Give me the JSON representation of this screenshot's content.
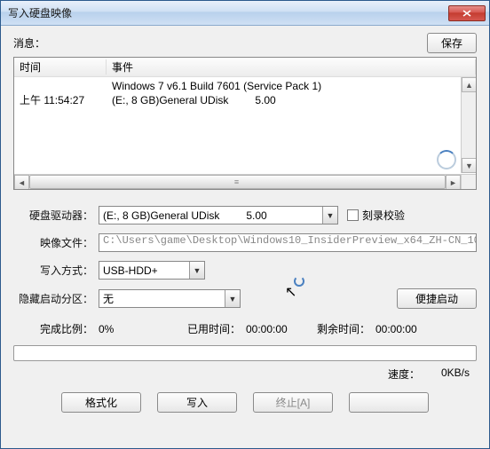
{
  "window": {
    "title": "写入硬盘映像"
  },
  "top": {
    "info_label": "消息：",
    "save_btn": "保存"
  },
  "log": {
    "headers": {
      "time": "时间",
      "event": "事件"
    },
    "rows": [
      {
        "time": "",
        "event": "Windows 7 v6.1 Build 7601 (Service Pack 1)"
      },
      {
        "time": "上午 11:54:27",
        "event": "(E:, 8 GB)General UDisk         5.00"
      }
    ]
  },
  "form": {
    "drive_label": "硬盘驱动器：",
    "drive_value": "(E:, 8 GB)General UDisk         5.00",
    "verify_label": "刻录校验",
    "image_label": "映像文件：",
    "image_value": "C:\\Users\\game\\Desktop\\Windows10_InsiderPreview_x64_ZH-CN_10",
    "write_mode_label": "写入方式：",
    "write_mode_value": "USB-HDD+",
    "hidden_label": "隐藏启动分区：",
    "hidden_value": "无",
    "convenient_boot_btn": "便捷启动"
  },
  "stats": {
    "done_label": "完成比例：",
    "done_value": "0%",
    "elapsed_label": "已用时间：",
    "elapsed_value": "00:00:00",
    "remain_label": "剩余时间：",
    "remain_value": "00:00:00"
  },
  "speed": {
    "label": "速度：",
    "value": "0KB/s"
  },
  "buttons": {
    "format": "格式化",
    "write": "写入",
    "abort": "终止[A]",
    "close": ""
  }
}
